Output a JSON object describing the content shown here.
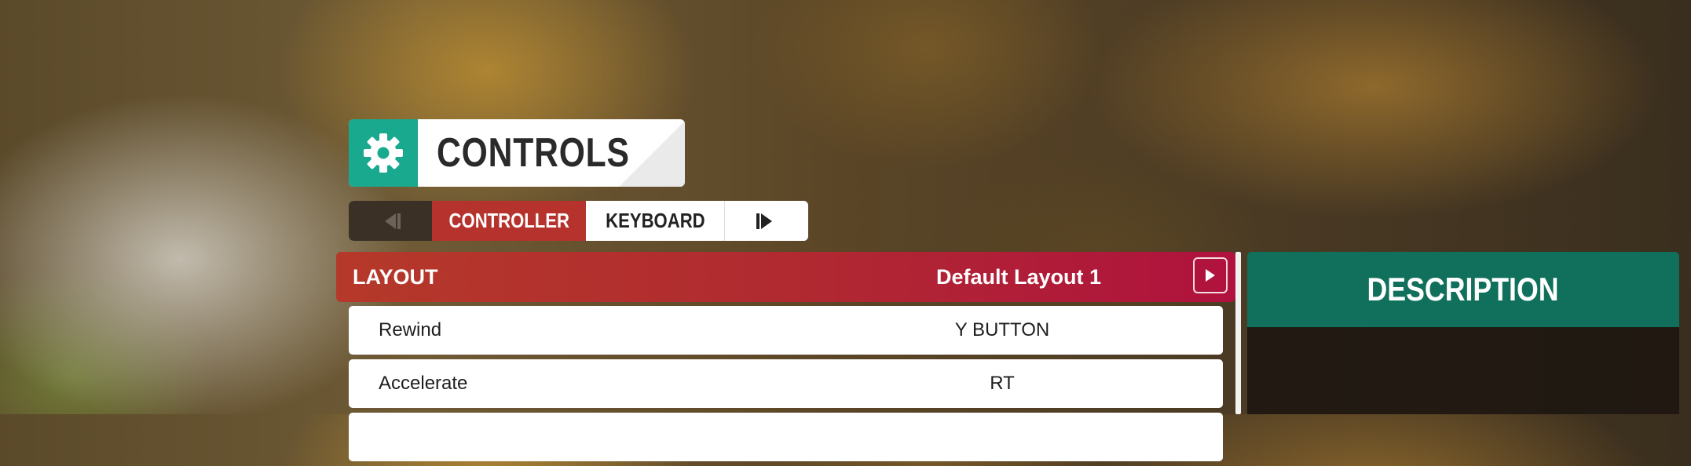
{
  "header": {
    "title": "CONTROLS",
    "icon": "gear-icon"
  },
  "tabs": [
    {
      "label": "CONTROLLER",
      "active": true
    },
    {
      "label": "KEYBOARD",
      "active": false
    }
  ],
  "layout": {
    "label": "LAYOUT",
    "value": "Default Layout 1"
  },
  "bindings": [
    {
      "action": "Rewind",
      "binding": "Y BUTTON"
    },
    {
      "action": "Accelerate",
      "binding": "RT"
    }
  ],
  "description": {
    "title": "DESCRIPTION"
  },
  "colors": {
    "accent_green": "#18a98e",
    "active_tab_red": "#b5332c",
    "layout_gradient_start": "#b5392a",
    "layout_gradient_end": "#b0123e",
    "description_header": "#11705c"
  }
}
